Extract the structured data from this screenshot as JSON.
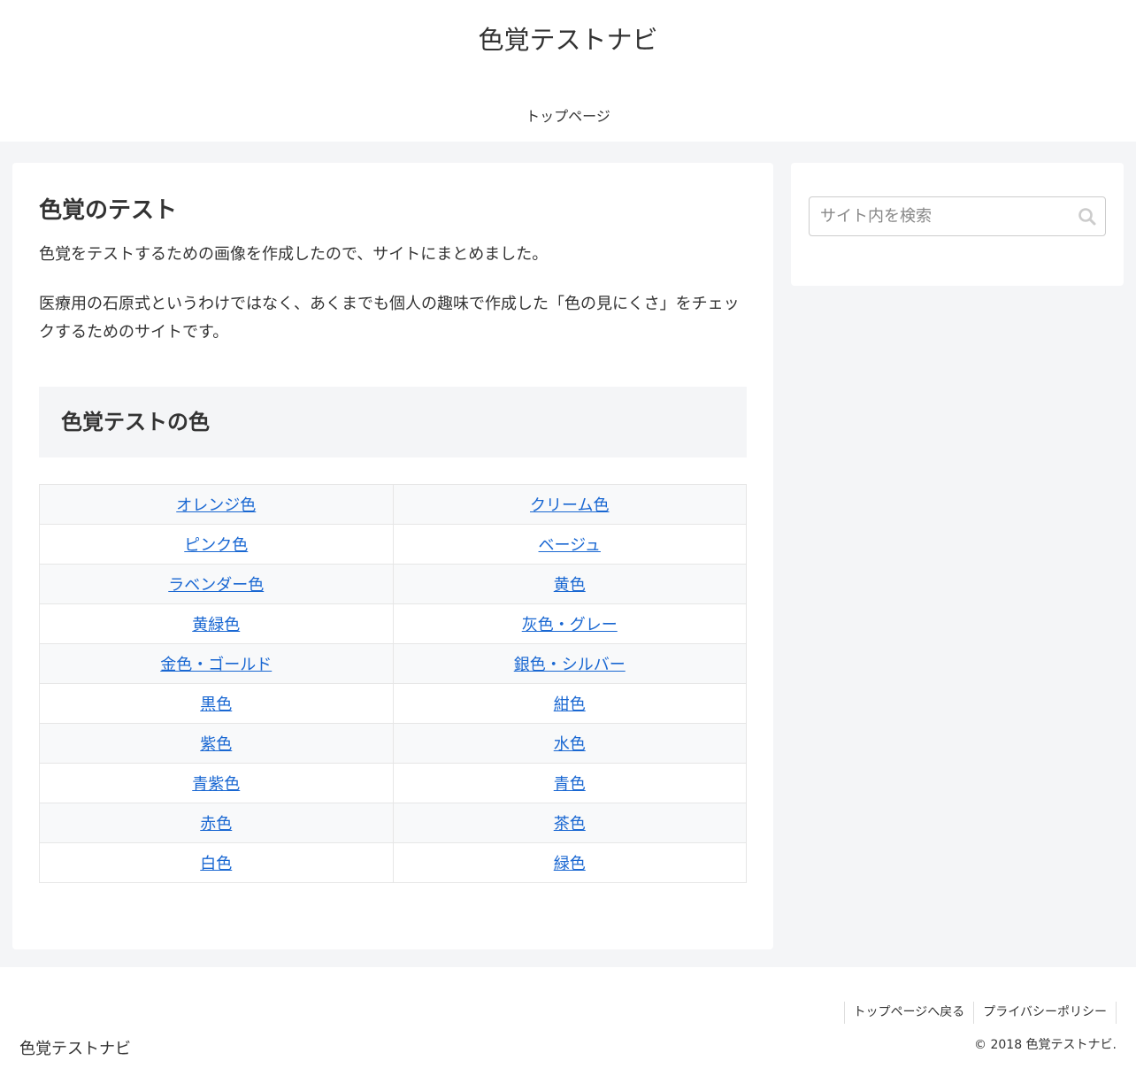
{
  "header": {
    "site_title": "色覚テストナビ",
    "nav": [
      {
        "label": "トップページ"
      }
    ]
  },
  "main": {
    "title": "色覚のテスト",
    "paragraphs": [
      "色覚をテストするための画像を作成したので、サイトにまとめました。",
      "医療用の石原式というわけではなく、あくまでも個人の趣味で作成した「色の見にくさ」をチェックするためのサイトです。"
    ],
    "section_heading": "色覚テストの色",
    "color_table": [
      [
        "オレンジ色",
        "クリーム色"
      ],
      [
        "ピンク色",
        "ベージュ"
      ],
      [
        "ラベンダー色",
        "黄色"
      ],
      [
        "黄緑色",
        "灰色・グレー"
      ],
      [
        "金色・ゴールド",
        "銀色・シルバー"
      ],
      [
        "黒色",
        "紺色"
      ],
      [
        "紫色",
        "水色"
      ],
      [
        "青紫色",
        "青色"
      ],
      [
        "赤色",
        "茶色"
      ],
      [
        "白色",
        "緑色"
      ]
    ]
  },
  "sidebar": {
    "search": {
      "placeholder": "サイト内を検索",
      "value": "",
      "icon": "search-icon"
    }
  },
  "footer": {
    "logo": "色覚テストナビ",
    "links": [
      {
        "label": "トップページへ戻る"
      },
      {
        "label": "プライバシーポリシー"
      }
    ],
    "copyright": "© 2018 色覚テストナビ."
  },
  "colors": {
    "link": "#1967d2",
    "page_background": "#f4f5f7",
    "text": "#333333"
  }
}
